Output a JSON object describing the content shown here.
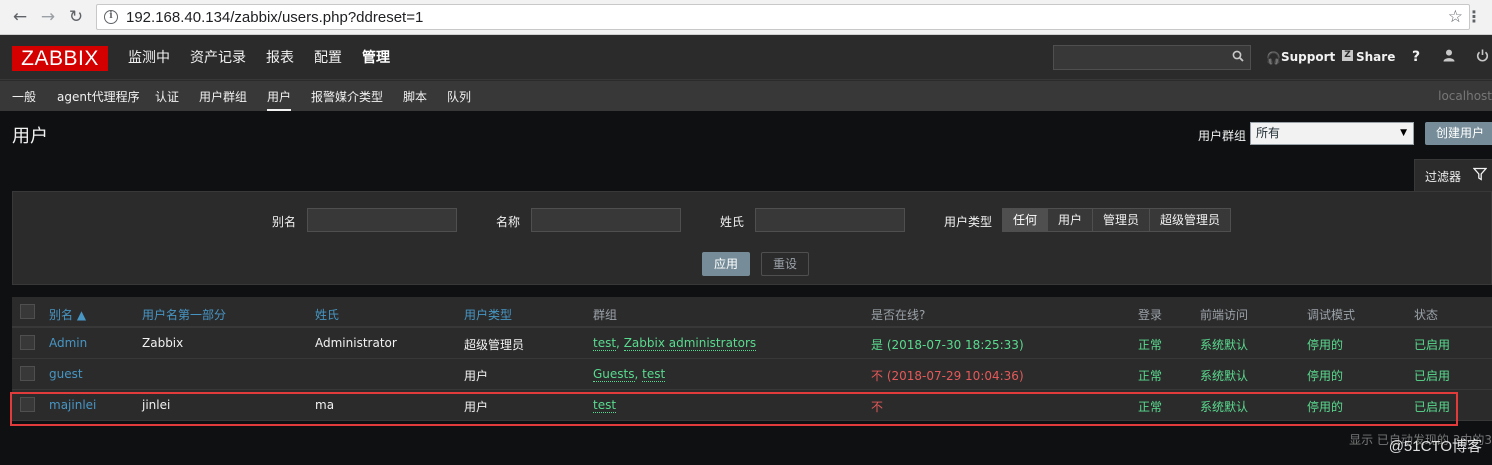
{
  "browser": {
    "url": "192.168.40.134/zabbix/users.php?ddreset=1",
    "back_icon": "←",
    "forward_icon": "→",
    "reload_icon": "↻",
    "star_icon": "☆",
    "menu_icon": "⋮",
    "info_icon": "i"
  },
  "header": {
    "logo": "ZABBIX",
    "menu": [
      "监测中",
      "资产记录",
      "报表",
      "配置",
      "管理"
    ],
    "active_menu": "管理",
    "support": "Support",
    "share": "Share",
    "help": "?",
    "user_icon": "👤",
    "logout_icon": "⏻"
  },
  "submenu": {
    "items": [
      "一般",
      "agent代理程序",
      "认证",
      "用户群组",
      "用户",
      "报警媒介类型",
      "脚本",
      "队列"
    ],
    "active": "用户",
    "server": "localhost"
  },
  "page": {
    "title": "用户",
    "group_label": "用户群组",
    "group_value": "所有",
    "create_button": "创建用户"
  },
  "filter": {
    "tab_label": "过滤器",
    "alias_label": "别名",
    "name_label": "名称",
    "surname_label": "姓氏",
    "user_type_label": "用户类型",
    "alias_value": "",
    "name_value": "",
    "surname_value": "",
    "user_type_options": [
      "任何",
      "用户",
      "管理员",
      "超级管理员"
    ],
    "user_type_selected": "任何",
    "apply": "应用",
    "reset": "重设"
  },
  "table": {
    "headers": {
      "alias": "别名 ▲",
      "name": "用户名第一部分",
      "surname": "姓氏",
      "type": "用户类型",
      "groups": "群组",
      "online": "是否在线?",
      "login": "登录",
      "frontend": "前端访问",
      "debug": "调试模式",
      "status": "状态"
    },
    "rows": [
      {
        "alias": "Admin",
        "name": "Zabbix",
        "surname": "Administrator",
        "type": "超级管理员",
        "group1": "test",
        "sep": ", ",
        "group2": "Zabbix administrators",
        "online": "是 (2018-07-30 18:25:33)",
        "login": "正常",
        "frontend": "系统默认",
        "debug": "停用的",
        "status": "已启用"
      },
      {
        "alias": "guest",
        "name": "",
        "surname": "",
        "type": "用户",
        "group1": "Guests",
        "sep": ", ",
        "group2": "test",
        "online": "不 (2018-07-29 10:04:36)",
        "login": "正常",
        "frontend": "系统默认",
        "debug": "停用的",
        "status": "已启用"
      },
      {
        "alias": "majinlei",
        "name": "jinlei",
        "surname": "ma",
        "type": "用户",
        "group1": "test",
        "sep": "",
        "group2": "",
        "online": "不",
        "login": "正常",
        "frontend": "系统默认",
        "debug": "停用的",
        "status": "已启用"
      }
    ]
  },
  "footer": {
    "note": "显示 已自动发现的 3中的3",
    "watermark": "@51CTO博客"
  }
}
